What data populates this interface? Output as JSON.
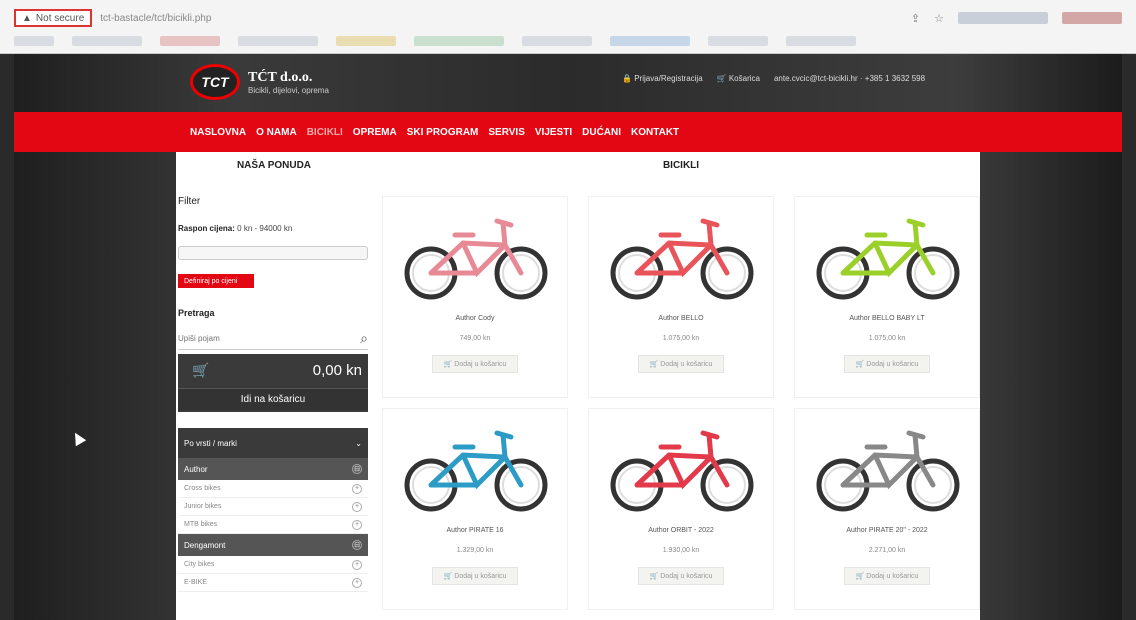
{
  "browser": {
    "not_secure": "Not secure",
    "url": "tct-bastacle/tct/bicikli.php"
  },
  "header": {
    "logo_mark": "TCT",
    "logo_title": "TĆT d.o.o.",
    "logo_sub": "Bicikli, dijelovi, oprema",
    "login": "Prijava/Registracija",
    "cart": "Košarica",
    "contact": "ante.cvcic@tct-bicikli.hr · +385 1 3632 598"
  },
  "nav": {
    "items": [
      "NASLOVNA",
      "O NAMA",
      "BICIKLI",
      "OPREMA",
      "SKI PROGRAM",
      "SERVIS",
      "VIJESTI",
      "DUĆANI",
      "KONTAKT"
    ]
  },
  "sidebar": {
    "title": "NAŠA PONUDA",
    "filter": "Filter",
    "price_label": "Raspon cijena:",
    "price_value": "0 kn - 94000 kn",
    "filter_button": "Definiraj po cijeni",
    "search_label": "Pretraga",
    "search_placeholder": "Upiši pojam",
    "cart_total": "0,00 kn",
    "cart_button": "Idi na košaricu",
    "cat_header": "Po vrsti / marki",
    "groups": [
      {
        "label": "Author",
        "subs": [
          "Cross bikes",
          "Junior bikes",
          "MTB bikes"
        ]
      },
      {
        "label": "Dengamont",
        "subs": [
          "City bikes",
          "E-BIKE"
        ]
      }
    ]
  },
  "main": {
    "title": "BICIKLI",
    "add_label": "Dodaj u košaricu",
    "products": [
      {
        "name": "Author Cody",
        "price": "749,00 kn",
        "color": "#e88a96"
      },
      {
        "name": "Author BELLO",
        "price": "1.075,00 kn",
        "color": "#e8545a"
      },
      {
        "name": "Author BELLO BABY LT",
        "price": "1.075,00 kn",
        "color": "#9bd02a"
      },
      {
        "name": "Author PIRATE 16",
        "price": "1.329,00 kn",
        "color": "#2c9cc6"
      },
      {
        "name": "Author ORBIT - 2022",
        "price": "1.930,00 kn",
        "color": "#e23a4a"
      },
      {
        "name": "Author PIRATE 20\" - 2022",
        "price": "2.271,00 kn",
        "color": "#888888"
      }
    ]
  }
}
